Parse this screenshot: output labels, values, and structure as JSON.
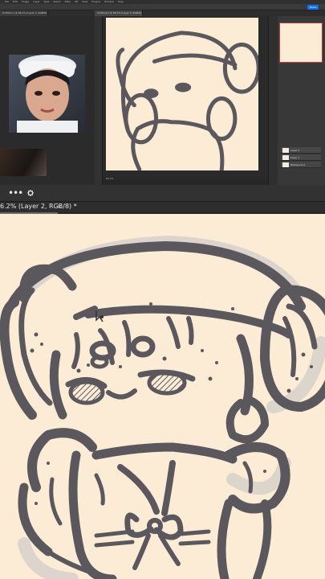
{
  "colors": {
    "canvas": "#fcecd6",
    "ink": "#5a575d",
    "ui_dark": "#262626",
    "panel": "#383838",
    "accent": "#1473e6"
  },
  "menu": {
    "items": [
      "File",
      "Edit",
      "Image",
      "Layer",
      "Type",
      "Select",
      "Filter",
      "3D",
      "View",
      "Plugins",
      "Window",
      "Help"
    ]
  },
  "share_button_label": "Share",
  "document_tabs": [
    "Untitled-1 @ 66.2% (Layer 2, RGB/8)",
    "Untitled-2 @ 66.2% (Layer 2, RGB/8)"
  ],
  "main_tab": {
    "title": "6.2% (Layer 2, RGB/8) *",
    "close_glyph": "×"
  },
  "taskbar": {
    "more_icon": "more-icon",
    "settings_icon": "gear-icon",
    "more_label": "•••"
  },
  "layers_panel": {
    "rows": [
      "Layer 2",
      "Layer 1",
      "Background"
    ]
  },
  "status_bar": "66.2%"
}
